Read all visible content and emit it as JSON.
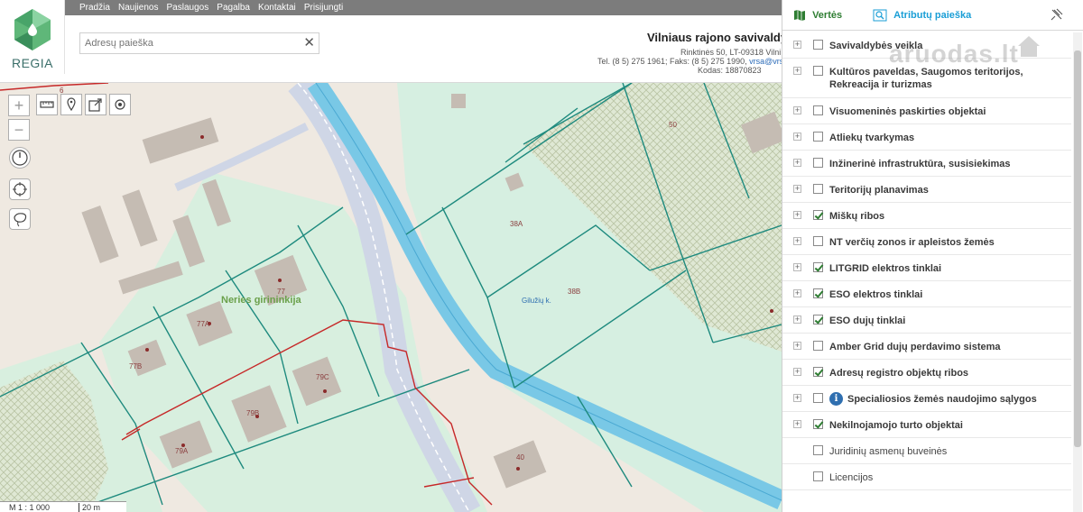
{
  "app": {
    "logo_text": "REGIA",
    "nav": [
      "Pradžia",
      "Naujienos",
      "Paslaugos",
      "Pagalba",
      "Kontaktai",
      "Prisijungti"
    ],
    "search": {
      "placeholder": "Adresų paieška"
    },
    "org": {
      "name": "Vilniaus rajono savivaldyb",
      "address": "Rinktinės 50, LT-09318 Vilni",
      "phone": "Tel. (8 5) 275 1961; Faks: (8 5) 275 1990, ",
      "email": "vrsa@vrsa",
      "code": "Kodas: 18870823"
    }
  },
  "map": {
    "scale_ratio": "M 1 : 1 000",
    "scale_distance": "20 m",
    "labels": {
      "l6": "6",
      "l50": "50",
      "l38a": "38A",
      "l38b": "38B",
      "l77": "77",
      "l77a": "77A",
      "l77b": "77B",
      "l79c": "79C",
      "l79b": "79B",
      "l79a": "79A",
      "l40": "40",
      "forest": "Neries girininkija",
      "area": "Gilužių k."
    }
  },
  "panel": {
    "tabs": {
      "layers": "Vertės",
      "attributes": "Atributų paieška"
    },
    "watermark": "aruodas.lt",
    "layers": [
      {
        "label": "Savivaldybės veikla",
        "checked": false,
        "expandable": true
      },
      {
        "label": "Kultūros paveldas, Saugomos teritorijos, Rekreacija ir turizmas",
        "checked": false,
        "expandable": true
      },
      {
        "label": "Visuomeninės paskirties objektai",
        "checked": false,
        "expandable": true
      },
      {
        "label": "Atliekų tvarkymas",
        "checked": false,
        "expandable": true
      },
      {
        "label": "Inžinerinė infrastruktūra, susisiekimas",
        "checked": false,
        "expandable": true
      },
      {
        "label": "Teritorijų planavimas",
        "checked": false,
        "expandable": true
      },
      {
        "label": "Miškų ribos",
        "checked": true,
        "expandable": true
      },
      {
        "label": "NT verčių zonos ir apleistos žemės",
        "checked": false,
        "expandable": true
      },
      {
        "label": "LITGRID elektros tinklai",
        "checked": true,
        "expandable": true
      },
      {
        "label": "ESO elektros tinklai",
        "checked": true,
        "expandable": true
      },
      {
        "label": "ESO dujų tinklai",
        "checked": true,
        "expandable": true
      },
      {
        "label": "Amber Grid dujų perdavimo sistema",
        "checked": false,
        "expandable": true
      },
      {
        "label": "Adresų registro objektų ribos",
        "checked": true,
        "expandable": true
      },
      {
        "label": "Specialiosios žemės naudojimo sąlygos",
        "checked": false,
        "expandable": true,
        "info": true
      },
      {
        "label": "Nekilnojamojo turto objektai",
        "checked": true,
        "expandable": true
      },
      {
        "label": "Juridinių asmenų buveinės",
        "checked": false,
        "expandable": false
      },
      {
        "label": "Licencijos",
        "checked": false,
        "expandable": false
      }
    ]
  }
}
